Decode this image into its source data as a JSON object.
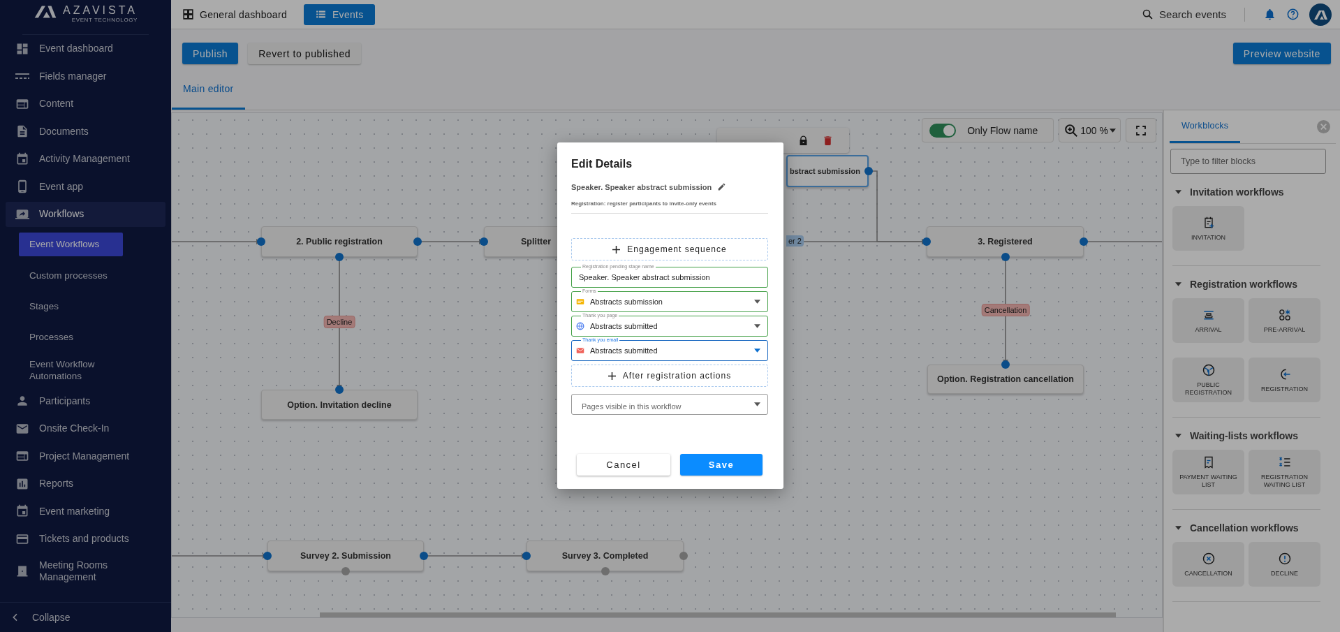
{
  "brand": {
    "name": "AZAVISTA",
    "tagline": "EVENT TECHNOLOGY"
  },
  "sidebar": {
    "items": [
      {
        "label": "Event dashboard",
        "selected": false
      },
      {
        "label": "Fields manager",
        "selected": false
      },
      {
        "label": "Content",
        "selected": false
      },
      {
        "label": "Documents",
        "selected": false
      },
      {
        "label": "Activity Management",
        "selected": false
      },
      {
        "label": "Event app",
        "selected": false
      },
      {
        "label": "Workflows",
        "selected": true,
        "children": [
          {
            "label": "Event Workflows",
            "selected": true
          },
          {
            "label": "Custom processes",
            "selected": false
          },
          {
            "label": "Stages",
            "selected": false
          },
          {
            "label": "Processes",
            "selected": false
          },
          {
            "label": "Event Workflow Automations",
            "selected": false
          }
        ]
      },
      {
        "label": "Participants",
        "selected": false
      },
      {
        "label": "Onsite Check-In",
        "selected": false
      },
      {
        "label": "Project Management",
        "selected": false
      },
      {
        "label": "Reports",
        "selected": false
      },
      {
        "label": "Event marketing",
        "selected": false
      },
      {
        "label": "Tickets and products",
        "selected": false
      },
      {
        "label": "Meeting Rooms Management",
        "selected": false
      }
    ],
    "collapse": "Collapse"
  },
  "topbar": {
    "tabs": [
      {
        "label": "General dashboard",
        "selected": false
      },
      {
        "label": "Events",
        "selected": true
      }
    ],
    "search": "Search events"
  },
  "toolbar": {
    "publish": "Publish",
    "revert": "Revert to published",
    "preview": "Preview website"
  },
  "editor_tabs": [
    {
      "label": "Main editor",
      "selected": true
    }
  ],
  "canvas": {
    "toggle": {
      "label": "Only Flow name",
      "on": true
    },
    "zoom": "100 %",
    "nodes": [
      {
        "label": "2. Public registration",
        "selected": false,
        "ports": [
          {
            "connected": true
          },
          {
            "connected": true
          },
          {
            "connected": true
          }
        ]
      },
      {
        "label": "Splitter",
        "selected": false,
        "ports": [
          {
            "connected": true
          }
        ]
      },
      {
        "label": "bstract submission",
        "selected": true,
        "ports": [
          {
            "connected": true
          }
        ]
      },
      {
        "label": "3. Registered",
        "selected": false,
        "ports": [
          {
            "connected": true
          },
          {
            "connected": true
          },
          {
            "connected": true
          }
        ]
      },
      {
        "label": "Option. Registration cancellation",
        "selected": false,
        "ports": [
          {
            "connected": true
          }
        ]
      },
      {
        "label": "Option. Invitation decline",
        "selected": false,
        "ports": [
          {
            "connected": true
          }
        ]
      },
      {
        "label": "Survey 2. Submission",
        "selected": false,
        "ports": [
          {
            "connected": true
          },
          {
            "connected": true
          },
          {
            "connected": false
          }
        ]
      },
      {
        "label": "Survey 3. Completed",
        "selected": false,
        "ports": [
          {
            "connected": true
          },
          {
            "connected": false
          },
          {
            "connected": false
          }
        ]
      }
    ],
    "edge_labels": [
      {
        "label": "er 2",
        "kind": "splitter"
      },
      {
        "label": "Decline",
        "kind": "negative"
      },
      {
        "label": "Cancellation",
        "kind": "negative"
      }
    ]
  },
  "workblocks": {
    "tab": "Workblocks",
    "filter_placeholder": "Type to filter blocks",
    "sections": [
      {
        "title": "Invitation workflows",
        "expanded": true,
        "blocks": [
          "INVITATION"
        ]
      },
      {
        "title": "Registration workflows",
        "expanded": true,
        "blocks": [
          "ARRIVAL",
          "PRE-ARRIVAL",
          "PUBLIC REGISTRATION",
          "REGISTRATION"
        ]
      },
      {
        "title": "Waiting-lists workflows",
        "expanded": true,
        "blocks": [
          "PAYMENT WAITING LIST",
          "REGISTRATION WAITING LIST"
        ]
      },
      {
        "title": "Cancellation workflows",
        "expanded": true,
        "blocks": [
          "CANCELLATION",
          "DECLINE"
        ]
      }
    ]
  },
  "dialog": {
    "title": "Edit Details",
    "stage_name": "Speaker. Speaker abstract submission",
    "description": "Registration: register participants to invite-only events",
    "items": [
      {
        "kind": "add",
        "label": "Engagement sequence"
      },
      {
        "kind": "text",
        "label": "Registration pending stage name",
        "value": "Speaker. Speaker abstract submission",
        "valid": true,
        "focused": false
      },
      {
        "kind": "select",
        "label": "Forms",
        "value": "Abstracts submission",
        "valid": true,
        "focused": false
      },
      {
        "kind": "select",
        "label": "Thank you page",
        "value": "Abstracts submitted",
        "valid": true,
        "focused": false
      },
      {
        "kind": "select",
        "label": "Thank you email",
        "value": "Abstracts submitted",
        "valid": false,
        "focused": true
      },
      {
        "kind": "add",
        "label": "After registration actions"
      },
      {
        "kind": "select",
        "placeholder": "Pages visible in this workflow",
        "valid": false,
        "focused": false
      }
    ],
    "buttons": [
      {
        "label": "Cancel",
        "primary": false
      },
      {
        "label": "Save",
        "primary": true
      }
    ]
  }
}
